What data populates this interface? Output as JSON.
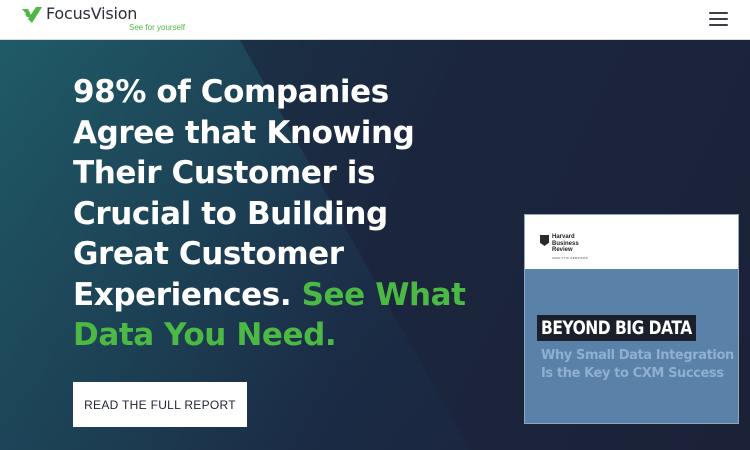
{
  "header": {
    "brand_name": "FocusVision",
    "tagline": "See for yourself",
    "menu_icon": "hamburger-menu-icon"
  },
  "hero": {
    "headline_white": "98% of Companies Agree that Knowing Their Customer is Crucial to Building Great Customer Experiences.",
    "headline_accent": " See What Data You Need.",
    "cta_label": "READ THE FULL REPORT"
  },
  "report_cover": {
    "publisher": "Harvard Business Review",
    "publisher_sub": "ANALYTIC SERVICES",
    "title": "BEYOND BIG DATA",
    "subtitle": "Why Small Data Integration Is the Key to CXM Success"
  },
  "colors": {
    "accent_green": "#4cb944",
    "hero_background": "#1b2238",
    "cover_blue": "#5a81a8"
  }
}
